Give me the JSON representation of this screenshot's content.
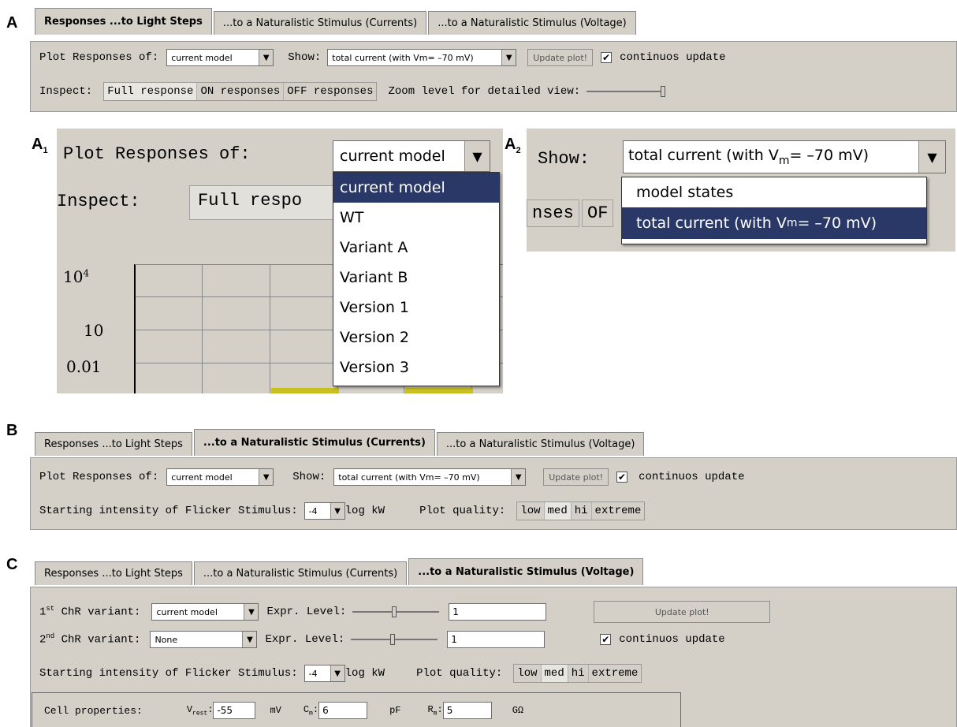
{
  "panel_labels": {
    "a": "A",
    "a1": "A",
    "a1_sub": "1",
    "a2": "A",
    "a2_sub": "2",
    "b": "B",
    "c": "C"
  },
  "tabs": {
    "light_steps": "Responses ...to Light Steps",
    "light_steps_suffix": "",
    "nat_currents_prefix": "...to a Naturalistic Stimulus (",
    "nat_currents_word": "Currents",
    "nat_currents_suffix": ")",
    "nat_voltage_prefix": "...to a Naturalistic Stimulus (",
    "nat_voltage_word": "Voltage",
    "nat_voltage_suffix": ")",
    "nat_currents_full": "...to a Naturalistic Stimulus (Currents)",
    "nat_voltage_full": "...to a Naturalistic Stimulus (Voltage)"
  },
  "panelA": {
    "plot_label": "Plot Responses of:",
    "plot_value": "current model",
    "show_label": "Show:",
    "show_value": "total current (with Vm= –70 mV)",
    "update_button": "Update plot!",
    "continuous_label": "continuos update",
    "inspect_label": "Inspect:",
    "inspect_options": [
      "Full response",
      "ON responses",
      "OFF responses"
    ],
    "zoom_label": "Zoom level for detailed view:"
  },
  "insetA1": {
    "plot_label": "Plot Responses of:",
    "combo_value": "current model",
    "inspect_label": "Inspect:",
    "inspect_visible": "Full respo",
    "partial_right": "nses",
    "dropdown_items": [
      "current model",
      "WT",
      "Variant A",
      "Variant B",
      "Version 1",
      "Version 2",
      "Version 3"
    ],
    "yticks": [
      "10",
      "10",
      "0.01"
    ],
    "ytick_exp": "4"
  },
  "insetA2": {
    "show_label": "Show:",
    "combo_value_prefix": "total current (with V",
    "combo_value_sub": "m",
    "combo_value_suffix": "= –70 mV)",
    "partial_left": "nses",
    "partial_left2": "OF",
    "dropdown_items": [
      "model states",
      "total current (with V",
      "m",
      "= –70 mV)"
    ]
  },
  "panelB": {
    "plot_label": "Plot Responses of:",
    "plot_value": "current model",
    "show_label": "Show:",
    "show_value": "total current (with Vm= –70 mV)",
    "update_button": "Update plot!",
    "continuous_label": "continuos update",
    "flicker_label": "Starting intensity of Flicker Stimulus:",
    "flicker_value": "-4",
    "flicker_unit": "log kW",
    "quality_label": "Plot quality:",
    "quality_options": [
      "low",
      "med",
      "hi",
      "extreme"
    ]
  },
  "panelC": {
    "variant1_label_num": "1",
    "variant1_label_sup": "st",
    "variant1_label": "ChR variant:",
    "variant1_value": "current model",
    "expr_label": "Expr. Level:",
    "expr1_value": "1",
    "update_button": "Update plot!",
    "variant2_label_num": "2",
    "variant2_label_sup": "nd",
    "variant2_label": "ChR variant:",
    "variant2_value": "None",
    "expr2_value": "1",
    "continuous_label": "continuos update",
    "flicker_label": "Starting intensity of Flicker Stimulus:",
    "flicker_value": "-4",
    "flicker_unit": "log kW",
    "quality_label": "Plot quality:",
    "quality_options": [
      "low",
      "med",
      "hi",
      "extreme"
    ],
    "cell_label": "Cell properties:",
    "vrest_label": "V",
    "vrest_sub": "rest",
    "vrest_value": "-55",
    "vrest_unit": "mV",
    "cm_label": "C",
    "cm_sub": "m",
    "cm_value": "6",
    "cm_unit": "pF",
    "rm_label": "R",
    "rm_sub": "m",
    "rm_value": "5",
    "rm_unit": "GΩ"
  },
  "colors": {
    "panel_bg": "#d4d0c8",
    "highlight": "#2a3867",
    "bar_yellow": "#c8c020"
  }
}
